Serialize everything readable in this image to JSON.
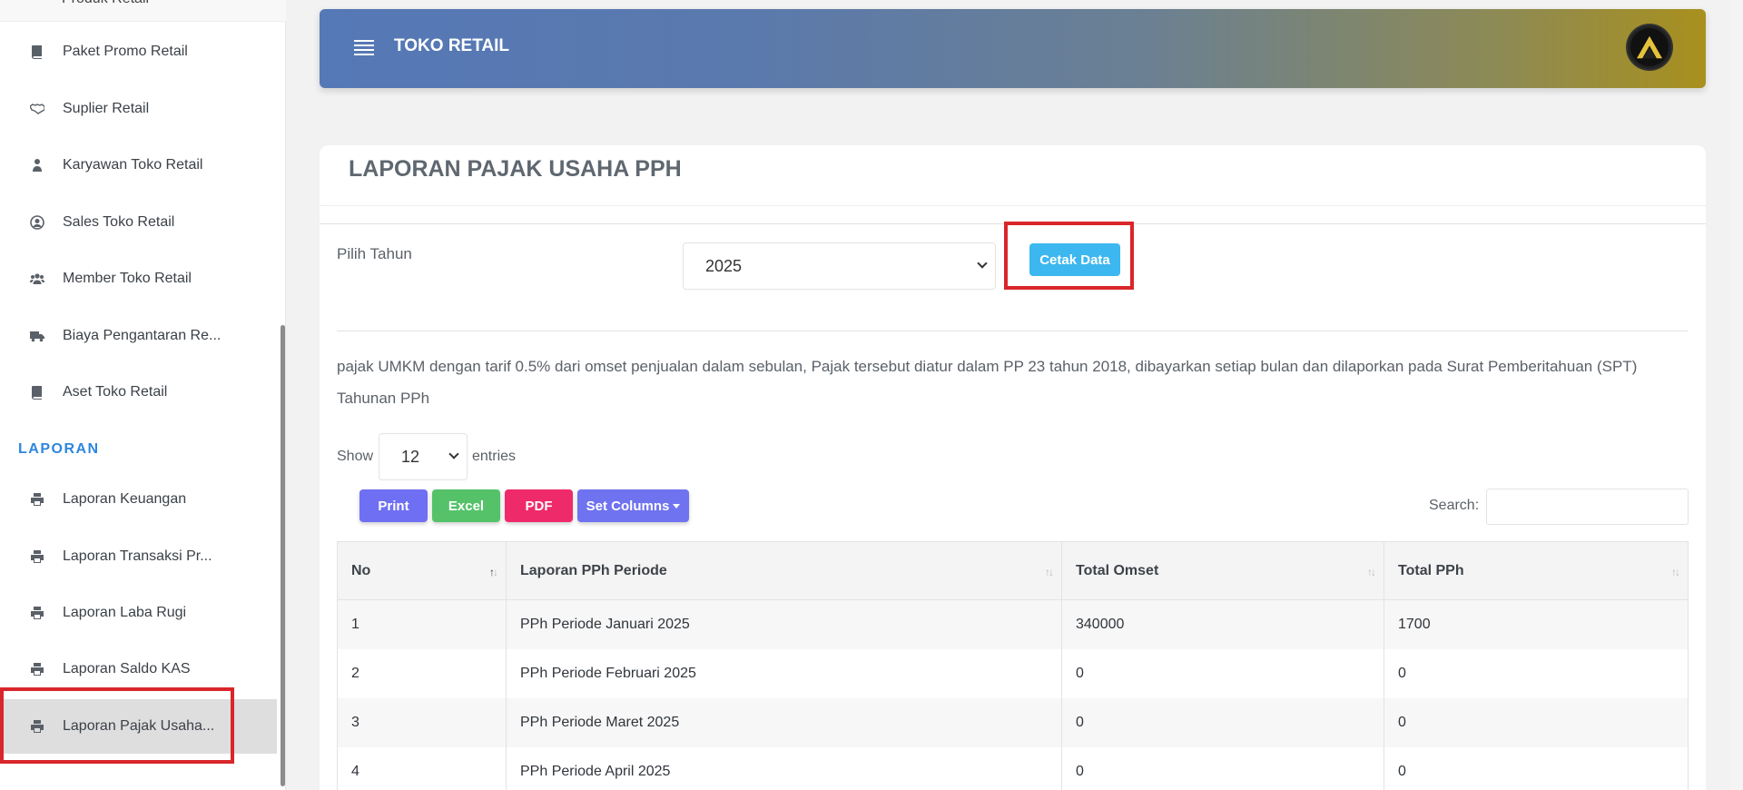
{
  "sidebar": {
    "partial_top_label": "Produk Retail",
    "items": [
      {
        "label": "Paket Promo Retail",
        "icon": "book-icon"
      },
      {
        "label": "Suplier Retail",
        "icon": "handshake-icon"
      },
      {
        "label": "Karyawan Toko Retail",
        "icon": "user-tie-icon"
      },
      {
        "label": "Sales Toko Retail",
        "icon": "user-circle-icon"
      },
      {
        "label": "Member Toko Retail",
        "icon": "users-icon"
      },
      {
        "label": "Biaya Pengantaran Re...",
        "icon": "truck-icon"
      },
      {
        "label": "Aset Toko Retail",
        "icon": "book-icon"
      }
    ],
    "section_label": "LAPORAN",
    "report_items": [
      {
        "label": "Laporan Keuangan",
        "icon": "print-icon"
      },
      {
        "label": "Laporan Transaksi Pr...",
        "icon": "print-icon"
      },
      {
        "label": "Laporan Laba Rugi",
        "icon": "print-icon"
      },
      {
        "label": "Laporan Saldo KAS",
        "icon": "print-icon"
      },
      {
        "label": "Laporan Pajak Usaha...",
        "icon": "print-icon",
        "active": true
      }
    ]
  },
  "header": {
    "title": "TOKO RETAIL"
  },
  "page": {
    "title": "LAPORAN PAJAK USAHA PPH",
    "year_label": "Pilih Tahun",
    "year_value": "2025",
    "print_button": "Cetak Data",
    "description": "pajak UMKM dengan tarif 0.5% dari omset penjualan dalam sebulan, Pajak tersebut diatur dalam PP 23 tahun 2018, dibayarkan setiap bulan dan dilaporkan pada Surat Pemberitahuan (SPT) Tahunan PPh",
    "show_label": "Show",
    "entries_value": "12",
    "entries_label": "entries",
    "search_label": "Search:",
    "buttons": {
      "print": "Print",
      "excel": "Excel",
      "pdf": "PDF",
      "columns": "Set Columns"
    }
  },
  "table": {
    "headers": [
      "No",
      "Laporan PPh Periode",
      "Total Omset",
      "Total PPh"
    ],
    "rows": [
      [
        "1",
        "PPh Periode Januari 2025",
        "340000",
        "1700"
      ],
      [
        "2",
        "PPh Periode Februari 2025",
        "0",
        "0"
      ],
      [
        "3",
        "PPh Periode Maret 2025",
        "0",
        "0"
      ],
      [
        "4",
        "PPh Periode April 2025",
        "0",
        "0"
      ]
    ]
  },
  "colors": {
    "accent": "#2e86de",
    "highlight": "#d9262a",
    "cetak_button": "#3db7ef",
    "print_button": "#6f6ff3",
    "excel_button": "#55c26a",
    "pdf_button": "#ef2a6a"
  }
}
